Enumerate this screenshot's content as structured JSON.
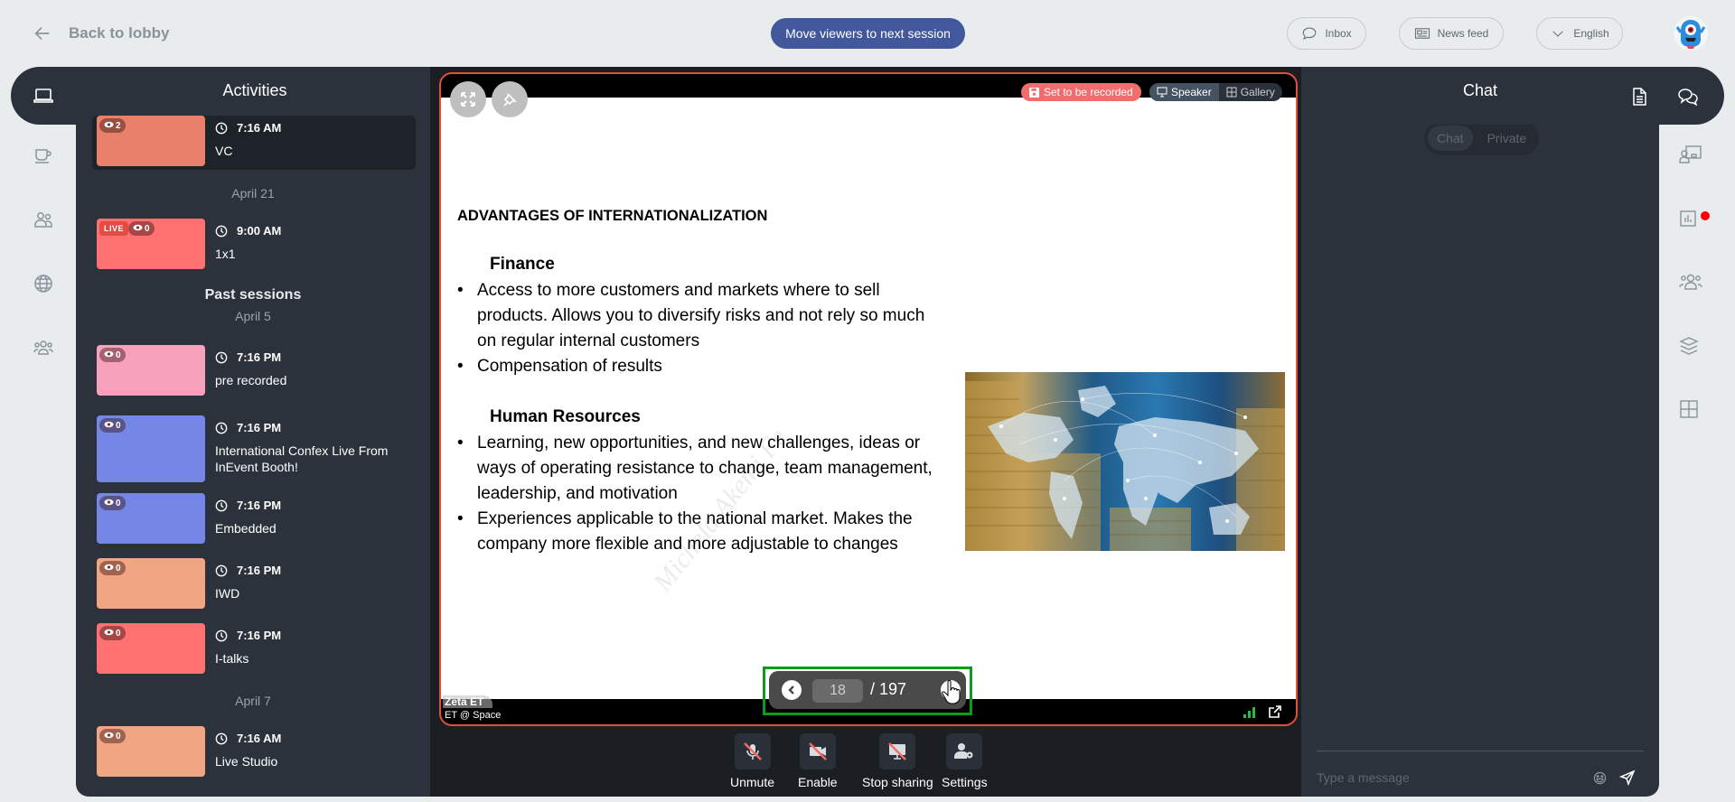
{
  "topbar": {
    "back_label": "Back to lobby",
    "move_viewers_label": "Move viewers to next session",
    "inbox_label": "Inbox",
    "news_feed_label": "News feed",
    "language_label": "English"
  },
  "activities": {
    "title": "Activities",
    "groups": [
      {
        "type": "session",
        "time": "7:16 AM",
        "name": "VC",
        "viewers": "2",
        "color": "#e8806a",
        "active": true,
        "live": false
      },
      {
        "type": "date",
        "label": "April 21"
      },
      {
        "type": "session",
        "time": "9:00 AM",
        "name": "1x1",
        "viewers": "0",
        "color": "#ff7070",
        "active": false,
        "live": true,
        "live_label": "LIVE"
      },
      {
        "type": "section",
        "label": "Past sessions"
      },
      {
        "type": "date",
        "label": "April 5"
      },
      {
        "type": "session",
        "time": "7:16 PM",
        "name": "pre recorded",
        "viewers": "0",
        "color": "#f7a1bd"
      },
      {
        "type": "session",
        "time": "7:16 PM",
        "name": "International Confex Live From InEvent Booth!",
        "viewers": "0",
        "color": "#7487e6"
      },
      {
        "type": "session",
        "time": "7:16 PM",
        "name": "Embedded",
        "viewers": "0",
        "color": "#7487e6"
      },
      {
        "type": "session",
        "time": "7:16 PM",
        "name": "IWD",
        "viewers": "0",
        "color": "#f1a582"
      },
      {
        "type": "session",
        "time": "7:16 PM",
        "name": "I-talks",
        "viewers": "0",
        "color": "#ff7070"
      },
      {
        "type": "date",
        "label": "April 7"
      },
      {
        "type": "session",
        "time": "7:16 AM",
        "name": "Live Studio",
        "viewers": "0",
        "color": "#f1a582"
      }
    ]
  },
  "stage": {
    "record_label": "Set to be recorded",
    "view_speaker": "Speaker",
    "view_gallery": "Gallery",
    "slide": {
      "title": "ADVANTAGES OF INTERNATIONALIZATION",
      "sections": [
        {
          "heading": "Finance",
          "bullets": [
            "Access to more customers and markets where to sell products. Allows you to diversify risks and not rely so much on regular internal customers",
            "Compensation of results"
          ]
        },
        {
          "heading": "Human Resources",
          "bullets": [
            "Learning, new opportunities, and new challenges, ideas or ways of operating resistance to change, team management, leadership, and motivation",
            "Experiences applicable to the national market. Makes the company more flexible and more adjustable to changes"
          ]
        }
      ],
      "watermark": "Michela Akemi Fe"
    },
    "pager": {
      "current": "18",
      "total": "/ 197"
    },
    "presenter": {
      "name": "Zeta ET",
      "role": "ET @ Space"
    }
  },
  "controls": {
    "unmute": "Unmute",
    "enable": "Enable",
    "stop_sharing": "Stop sharing",
    "settings": "Settings"
  },
  "chat": {
    "title": "Chat",
    "tabs": [
      "Chat",
      "Private"
    ],
    "input_placeholder": "Type a message"
  },
  "colors": {
    "accent": "#42579c",
    "stage_border": "#e0503f",
    "record": "#f26d6d",
    "pager_highlight": "#0d9b1d",
    "notification": "#ff0000"
  }
}
